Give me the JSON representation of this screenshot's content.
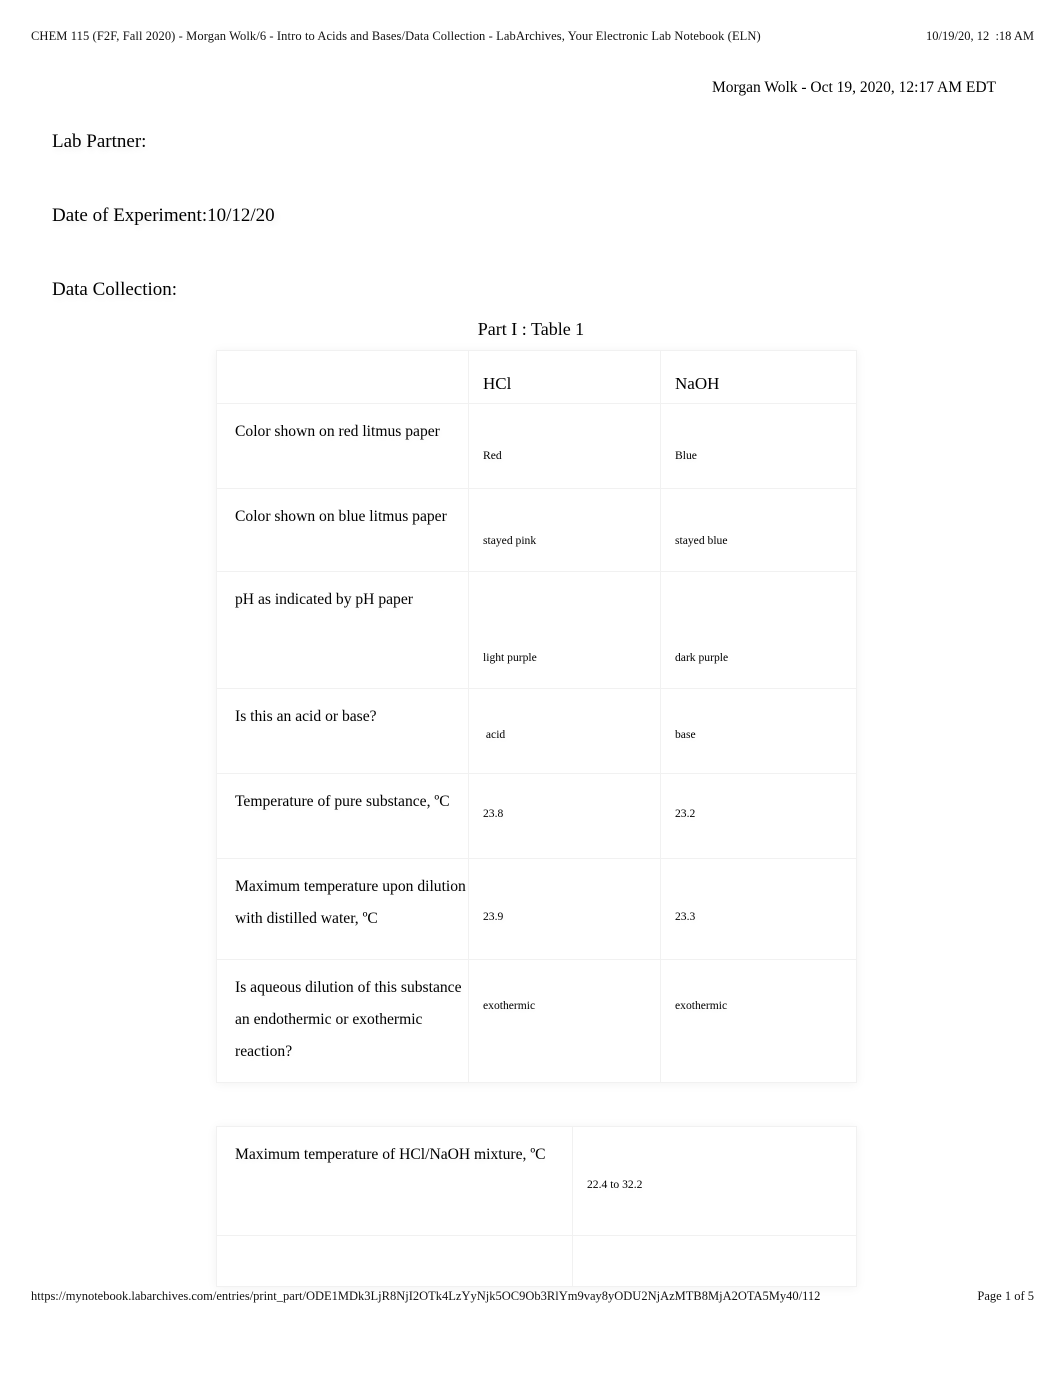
{
  "print_header": {
    "title": "CHEM 115 (F2F, Fall 2020) - Morgan Wolk/6 - Intro to Acids and Bases/Data Collection - LabArchives, Your Electronic Lab Notebook (ELN)",
    "timestamp": "10/19/20, 12  :18 AM"
  },
  "print_footer": {
    "url": "https://mynotebook.labarchives.com/entries/print_part/ODE1MDk3LjR8NjI2OTk4LzYyNjk5OC9Ob3RlYm9vay8yODU2NjAzMTB8MjA2OTA5My40/112",
    "page": "Page 1 of 5"
  },
  "entry": {
    "byline": "Morgan Wolk - Oct 19, 2020, 12:17 AM EDT",
    "lab_partner": "Lab Partner:",
    "date_of_experiment": "Date of Experiment:10/12/20",
    "data_collection": "Data Collection:"
  },
  "table1": {
    "title": "Part I : Table 1",
    "columns": [
      "",
      "HCl",
      "NaOH"
    ],
    "rows": [
      {
        "label": "Color shown on red litmus paper",
        "hcl": "Red",
        "naoh": "Blue"
      },
      {
        "label": "Color shown on blue litmus paper",
        "hcl": "stayed pink",
        "naoh": "stayed blue"
      },
      {
        "label": "pH as indicated by pH paper",
        "hcl": "light purple",
        "naoh": "dark purple"
      },
      {
        "label": "Is this an acid or base?",
        "hcl": " acid",
        "naoh": "base"
      },
      {
        "label": "Temperature of pure substance,  ºC",
        "hcl": "23.8",
        "naoh": "23.2"
      },
      {
        "label": "Maximum temperature upon dilution with distilled water,  ºC",
        "hcl": "23.9",
        "naoh": "23.3"
      },
      {
        "label": "Is aqueous dilution of this substance an endothermic or exothermic reaction?",
        "hcl": "exothermic",
        "naoh": "exothermic"
      }
    ]
  },
  "table2": {
    "rows": [
      {
        "label": "Maximum temperature of HCl/NaOH mixture,  ºC",
        "value": "22.4 to 32.2"
      },
      {
        "label": "",
        "value": ""
      }
    ]
  },
  "colors": {
    "page_background": "#ffffff",
    "text": "#000000",
    "table_border": "#f1f1f1"
  }
}
